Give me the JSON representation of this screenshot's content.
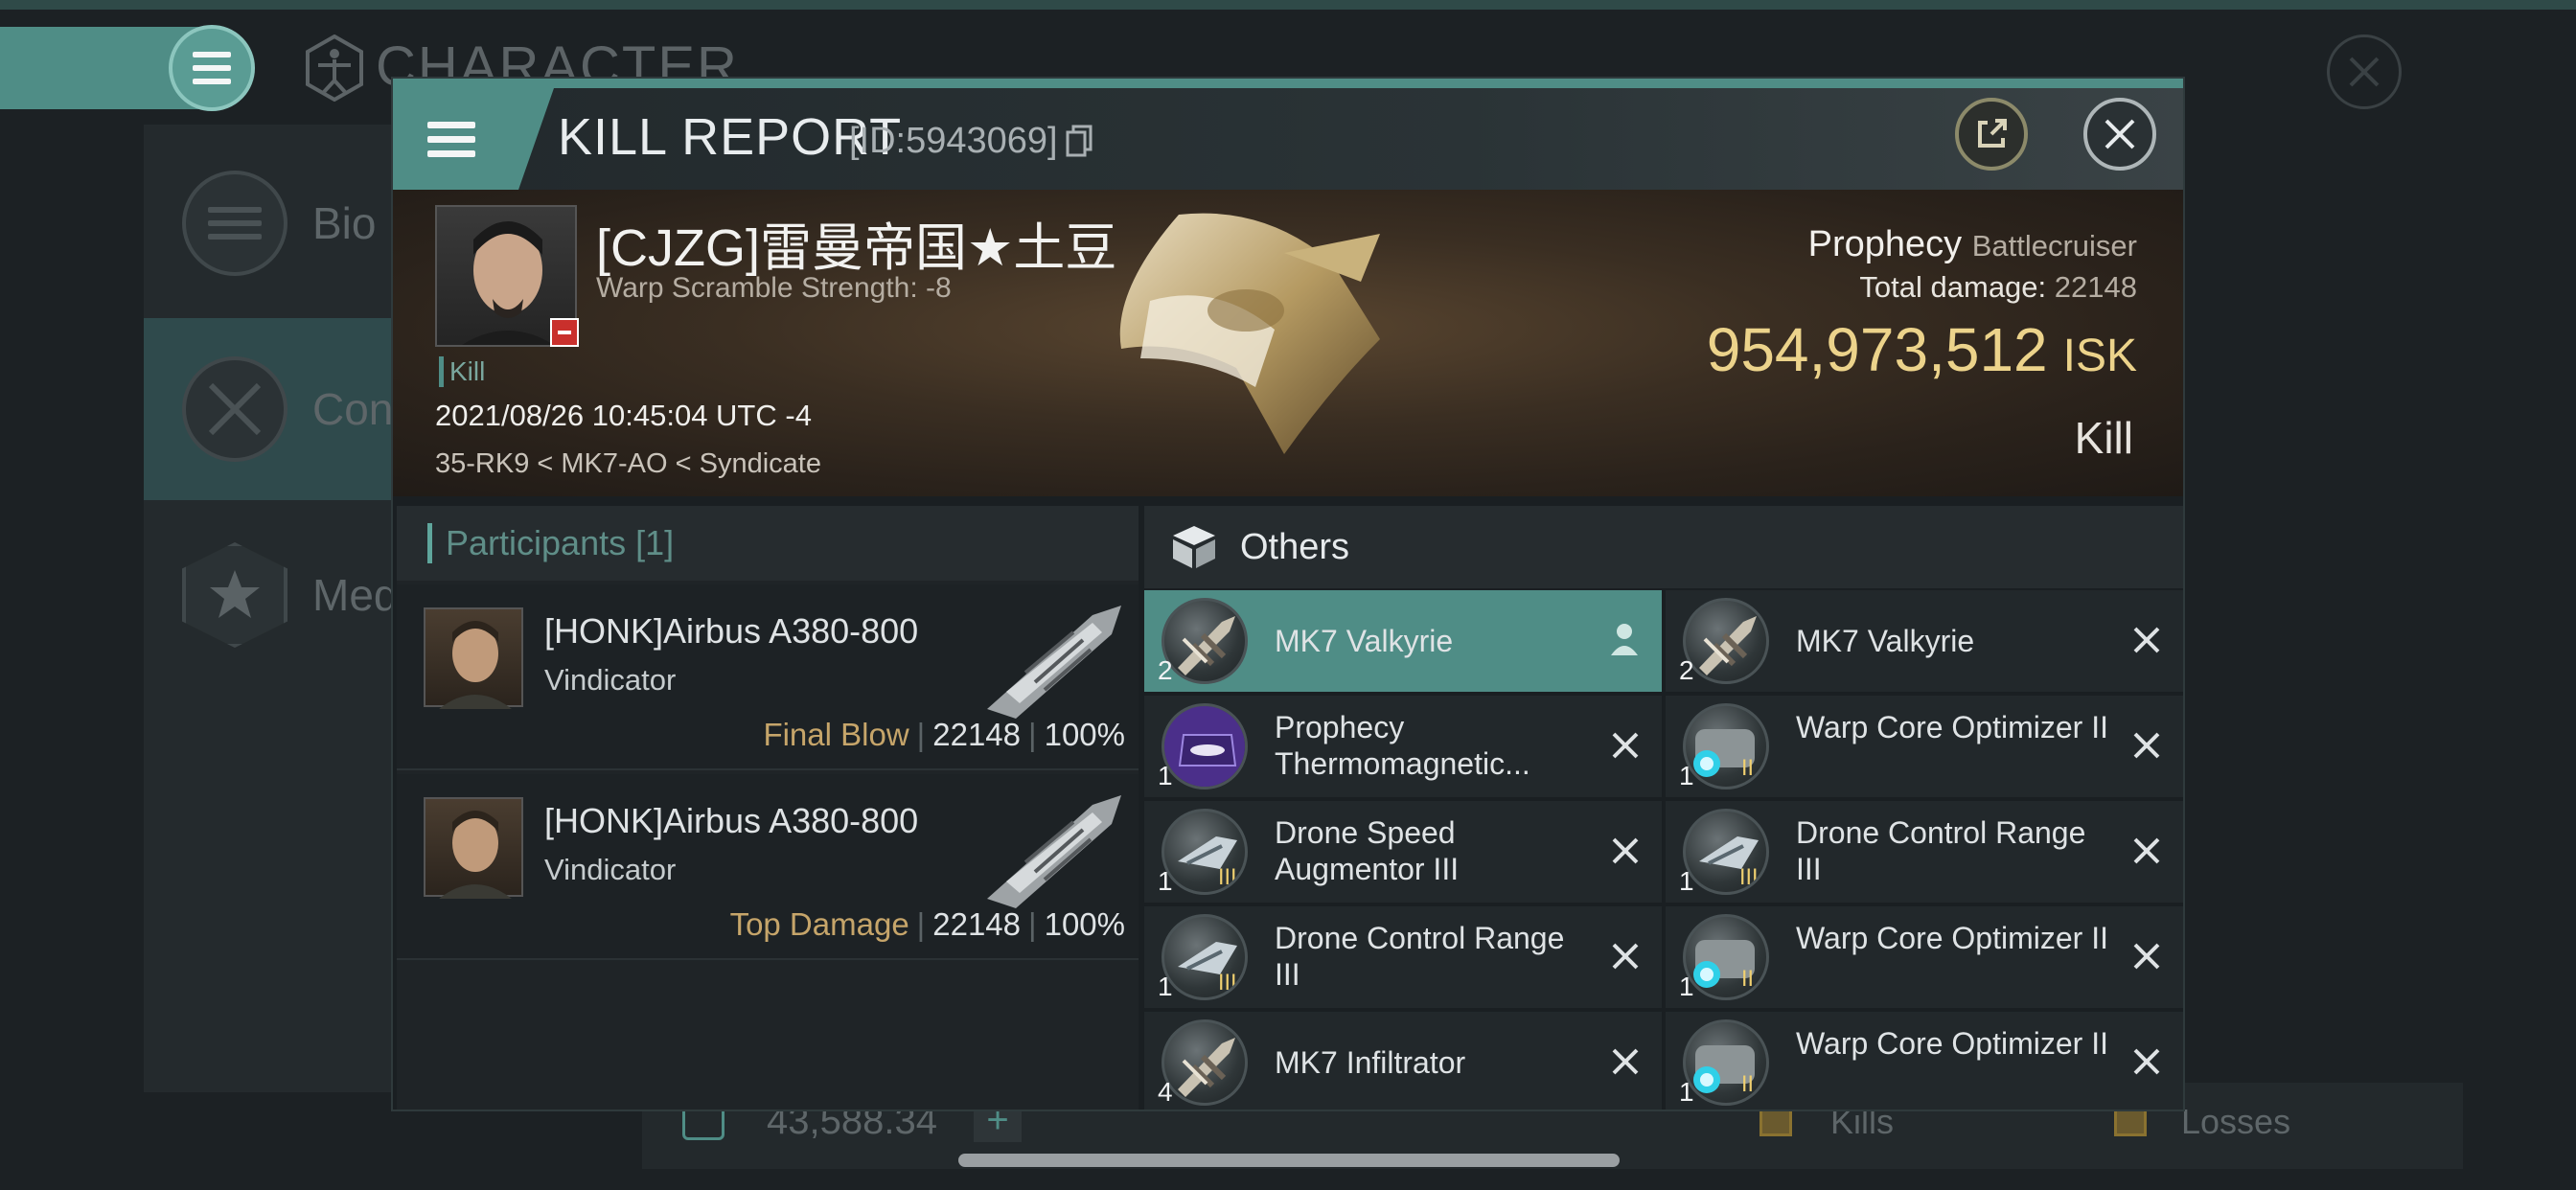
{
  "background": {
    "title": "CHARACTER",
    "side_items": [
      {
        "label": "Bio",
        "icon": "list-icon"
      },
      {
        "label": "Con",
        "icon": "swords-icon"
      },
      {
        "label": "Med",
        "icon": "star-medal-icon"
      }
    ],
    "balance": "43,588.34",
    "plus_label": "+",
    "legend": [
      "Kills",
      "Losses"
    ]
  },
  "dialog": {
    "title": "KILL REPORT",
    "id_text": "[ID:5943069]"
  },
  "victim": {
    "name": "[CJZG]雷曼帝国★土豆",
    "warp_scramble": "Warp Scramble Strength: -8",
    "kill_tag": "Kill",
    "timestamp": "2021/08/26 10:45:04 UTC -4",
    "location": "35-RK9 < MK7-AO < Syndicate",
    "ship_name": "Prophecy",
    "ship_class": "Battlecruiser",
    "total_damage_label": "Total damage:",
    "total_damage": "22148",
    "isk_value": "954,973,512",
    "isk_unit": "ISK",
    "result_label": "Kill"
  },
  "participants": {
    "title": "Participants [1]",
    "rows": [
      {
        "name": "[HONK]Airbus A380-800",
        "ship": "Vindicator",
        "tag": "Final Blow",
        "damage": "22148",
        "percent": "100%"
      },
      {
        "name": "[HONK]Airbus A380-800",
        "ship": "Vindicator",
        "tag": "Top Damage",
        "damage": "22148",
        "percent": "100%"
      }
    ]
  },
  "others": {
    "title": "Others",
    "items": [
      {
        "name": "MK7  Valkyrie",
        "qty": "2",
        "icon": "drone-icon",
        "action": "person-icon",
        "active": true
      },
      {
        "name": "MK7  Valkyrie",
        "qty": "2",
        "icon": "drone-icon",
        "action": "close-icon",
        "active": false
      },
      {
        "name": "Prophecy Thermomagnetic...",
        "qty": "1",
        "icon": "skin-icon",
        "action": "close-icon",
        "active": false
      },
      {
        "name": "Warp Core Optimizer II",
        "qty": "1",
        "icon": "warp-core-icon",
        "action": "close-icon",
        "active": false
      },
      {
        "name": "Drone Speed Augmentor III",
        "qty": "1",
        "icon": "drone-module-icon",
        "action": "close-icon",
        "active": false
      },
      {
        "name": "Drone Control Range III",
        "qty": "1",
        "icon": "drone-module-icon",
        "action": "close-icon",
        "active": false
      },
      {
        "name": "Drone Control Range III",
        "qty": "1",
        "icon": "drone-module-icon",
        "action": "close-icon",
        "active": false
      },
      {
        "name": "Warp Core Optimizer II",
        "qty": "1",
        "icon": "warp-core-icon",
        "action": "close-icon",
        "active": false
      },
      {
        "name": "MK7  Infiltrator",
        "qty": "4",
        "icon": "drone-icon",
        "action": "close-icon",
        "active": false
      },
      {
        "name": "Warp Core Optimizer II",
        "qty": "1",
        "icon": "warp-core-icon",
        "action": "close-icon",
        "active": false
      }
    ]
  },
  "colors": {
    "accent": "#4f8d86",
    "isk": "#ecd38b",
    "tag": "#c6a56a"
  }
}
